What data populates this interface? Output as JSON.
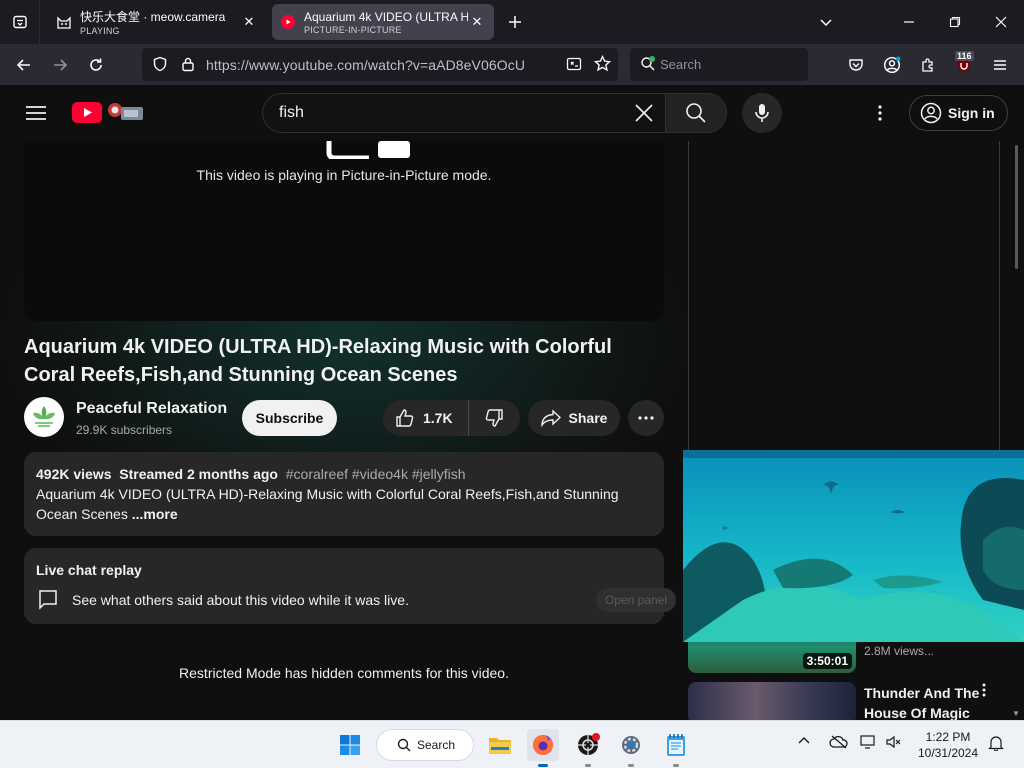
{
  "browser": {
    "tabs": [
      {
        "title": "快乐大食堂 · meow.camera",
        "status": "PLAYING",
        "active": false
      },
      {
        "title": "Aquarium 4k VIDEO (ULTRA HD",
        "status": "PICTURE-IN-PICTURE",
        "active": true
      }
    ],
    "url": "https://www.youtube.com/watch?v=aAD8eV06OcU",
    "search_placeholder": "Search",
    "extension_badge": "116"
  },
  "youtube": {
    "search_query": "fish",
    "sign_in_label": "Sign in",
    "pip_message": "This video is playing in Picture-in-Picture mode.",
    "video_title": "Aquarium 4k VIDEO (ULTRA HD)-Relaxing Music with Colorful Coral Reefs,Fish,and Stunning Ocean Scenes",
    "channel": {
      "name": "Peaceful Relaxation",
      "subscribers": "29.9K subscribers"
    },
    "subscribe_label": "Subscribe",
    "likes": "1.7K",
    "share_label": "Share",
    "description": {
      "views": "492K views",
      "date": "Streamed 2 months ago",
      "tags": "#coralreef #video4k #jellyfish",
      "text": "Aquarium 4k VIDEO (ULTRA HD)-Relaxing Music with Colorful Coral Reefs,Fish,and Stunning Ocean Scenes",
      "more_label": "...more"
    },
    "live_chat": {
      "heading": "Live chat replay",
      "text": "See what others said about this video while it was live.",
      "button": "Open panel"
    },
    "restricted_message": "Restricted Mode has hidden comments for this video.",
    "related": [
      {
        "duration": "3:50:01",
        "meta": "2.8M views..."
      },
      {
        "title": "Thunder And The House Of Magic"
      }
    ]
  },
  "taskbar": {
    "search_label": "Search",
    "time": "1:22 PM",
    "date": "10/31/2024"
  }
}
